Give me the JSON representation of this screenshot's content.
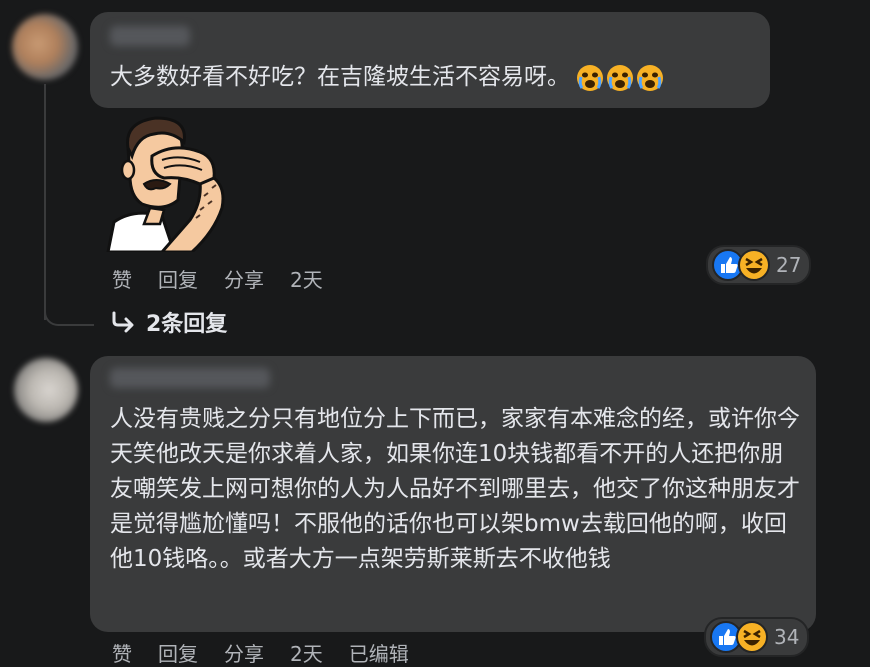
{
  "comments": [
    {
      "text": "大多数好看不好吃？在吉隆坡生活不容易呀。",
      "emoji": [
        "crying-face-icon",
        "crying-face-icon",
        "crying-face-icon"
      ],
      "actions": {
        "like": "赞",
        "reply": "回复",
        "share": "分享",
        "time": "2天"
      },
      "reaction_count": "27",
      "replies_link": "2条回复"
    },
    {
      "text": "人没有贵贱之分只有地位分上下而已，家家有本难念的经，或许你今天笑他改天是你求着人家，如果你连10块钱都看不开的人还把你朋友嘲笑发上网可想你的人为人品好不到哪里去，他交了你这种朋友才是觉得尴尬懂吗！不服他的话你也可以架bmw去载回他的啊，收回他10钱咯。。或者大方一点架劳斯莱斯去不收他钱",
      "actions": {
        "like": "赞",
        "reply": "回复",
        "share": "分享",
        "time": "2天",
        "edited": "已编辑"
      },
      "reaction_count": "34"
    }
  ],
  "colors": {
    "background": "#18191a",
    "bubble": "#3a3b3c",
    "meta": "#b0b3b8",
    "like_blue": "#1877f2",
    "haha_yellow": "#f7b125"
  }
}
